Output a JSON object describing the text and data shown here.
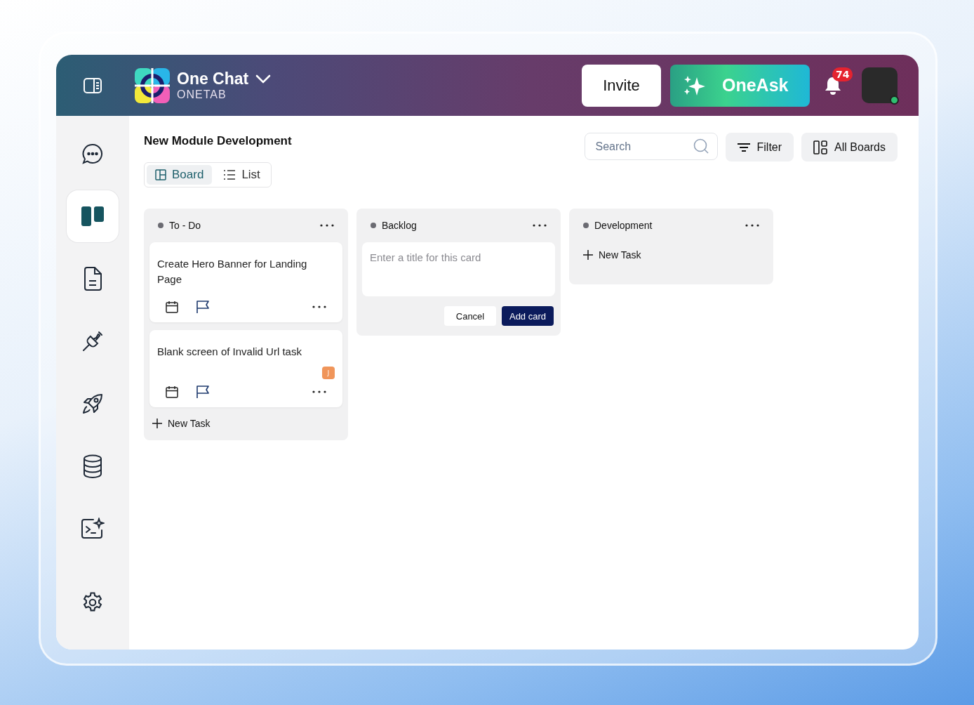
{
  "header": {
    "app_name": "One Chat",
    "workspace": "ONETAB",
    "invite": "Invite",
    "oneask": "OneAsk",
    "notification_count": "74"
  },
  "sidebar": {
    "items": [
      {
        "selected": false
      },
      {
        "selected": true
      },
      {
        "selected": false
      },
      {
        "selected": false
      },
      {
        "selected": false
      },
      {
        "selected": false
      },
      {
        "selected": false
      },
      {
        "selected": false
      }
    ]
  },
  "page": {
    "title": "New Module Development",
    "views": [
      {
        "label": "Board",
        "selected": true
      },
      {
        "label": "List",
        "selected": false
      }
    ],
    "search": {
      "placeholder": "Search"
    },
    "filter": "Filter",
    "all_boards": "All Boards"
  },
  "columns": [
    {
      "title": "To - Do",
      "cards": [
        {
          "title": "Create Hero Banner for Landing Page"
        },
        {
          "title": "Blank screen of Invalid Url task",
          "assignee": "J"
        }
      ],
      "new_task": "New Task"
    },
    {
      "title": "Backlog",
      "composer": {
        "placeholder": "Enter a title for this card",
        "cancel": "Cancel",
        "add": "Add card"
      }
    },
    {
      "title": "Development",
      "new_task": "New Task"
    }
  ]
}
